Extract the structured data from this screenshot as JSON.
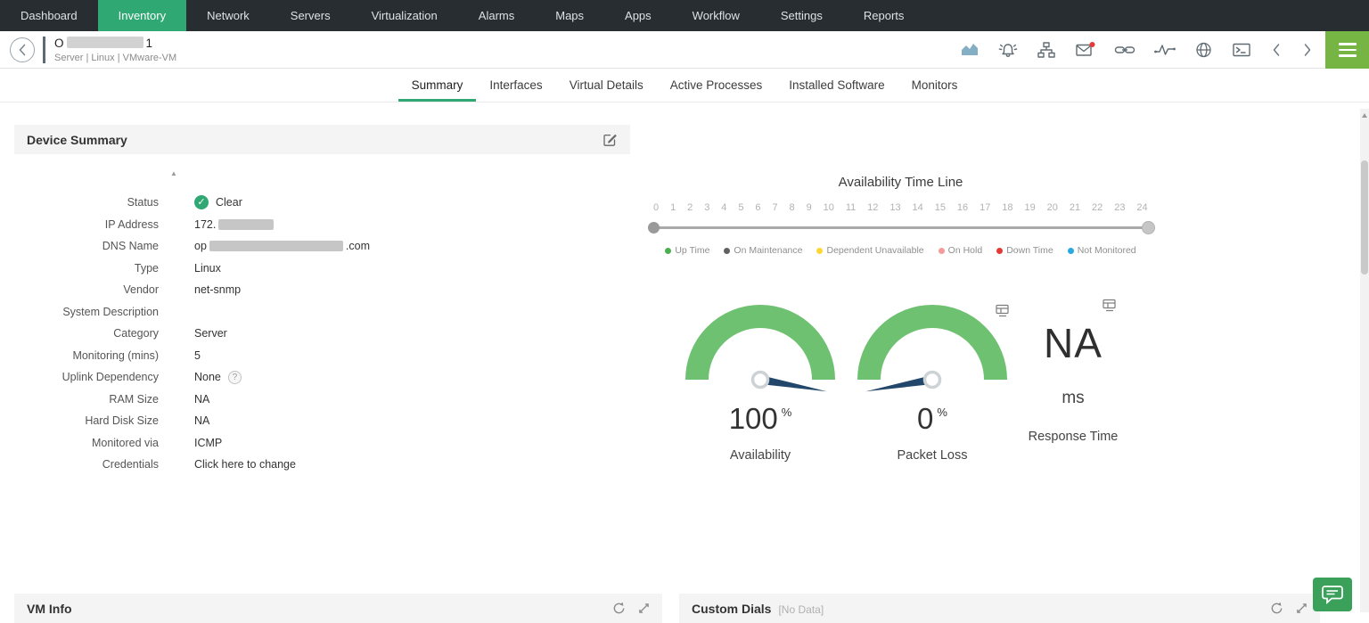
{
  "nav": {
    "items": [
      "Dashboard",
      "Inventory",
      "Network",
      "Servers",
      "Virtualization",
      "Alarms",
      "Maps",
      "Apps",
      "Workflow",
      "Settings",
      "Reports"
    ],
    "active": "Inventory"
  },
  "device_header": {
    "name_prefix": "O",
    "name_suffix": "1",
    "breadcrumb": "Server | Linux | VMware-VM",
    "icons": [
      "performance-chart-icon",
      "alarm-icon",
      "topology-icon",
      "mail-icon",
      "link-icon",
      "response-graph-icon",
      "web-icon",
      "terminal-icon",
      "previous-device-icon",
      "next-device-icon",
      "menu-icon"
    ]
  },
  "tabs": {
    "items": [
      "Summary",
      "Interfaces",
      "Virtual Details",
      "Active Processes",
      "Installed Software",
      "Monitors"
    ],
    "active": "Summary"
  },
  "device_summary": {
    "title": "Device Summary",
    "fields": [
      {
        "label": "Status",
        "value": "Clear",
        "type": "status"
      },
      {
        "label": "IP Address",
        "value": "172.",
        "type": "redacted",
        "redact_width": 62,
        "suffix": ""
      },
      {
        "label": "DNS Name",
        "value": "op",
        "type": "redacted",
        "redact_width": 150,
        "suffix": ".com"
      },
      {
        "label": "Type",
        "value": "Linux",
        "type": "text"
      },
      {
        "label": "Vendor",
        "value": "net-snmp",
        "type": "text"
      },
      {
        "label": "System Description",
        "value": "",
        "type": "text"
      },
      {
        "label": "Category",
        "value": "Server",
        "type": "text"
      },
      {
        "label": "Monitoring (mins)",
        "value": "5",
        "type": "text"
      },
      {
        "label": "Uplink Dependency",
        "value": "None",
        "type": "help"
      },
      {
        "label": "RAM Size",
        "value": "NA",
        "type": "text"
      },
      {
        "label": "Hard Disk Size",
        "value": "NA",
        "type": "text"
      },
      {
        "label": "Monitored via",
        "value": "ICMP",
        "type": "text"
      },
      {
        "label": "Credentials",
        "value": "Click here to change",
        "type": "link"
      }
    ]
  },
  "timeline": {
    "title": "Availability Time Line",
    "ticks": [
      "0",
      "1",
      "2",
      "3",
      "4",
      "5",
      "6",
      "7",
      "8",
      "9",
      "10",
      "11",
      "12",
      "13",
      "14",
      "15",
      "16",
      "17",
      "18",
      "19",
      "20",
      "21",
      "22",
      "23",
      "24"
    ],
    "legend": [
      {
        "label": "Up Time",
        "color": "#4caf50"
      },
      {
        "label": "On Maintenance",
        "color": "#616161"
      },
      {
        "label": "Dependent Unavailable",
        "color": "#fdd835"
      },
      {
        "label": "On Hold",
        "color": "#f49c9c"
      },
      {
        "label": "Down Time",
        "color": "#e53935"
      },
      {
        "label": "Not Monitored",
        "color": "#29a9e0"
      }
    ]
  },
  "dials": [
    {
      "type": "gauge",
      "value": "100",
      "unit": "%",
      "label": "Availability",
      "needle_deg": 10
    },
    {
      "type": "gauge",
      "value": "0",
      "unit": "%",
      "label": "Packet Loss",
      "needle_deg": 170
    },
    {
      "type": "text",
      "value": "NA",
      "unit": "ms",
      "label": "Response Time"
    }
  ],
  "panels": {
    "vm_info": {
      "title": "VM Info"
    },
    "custom_dials": {
      "title": "Custom Dials",
      "no_data": "[No Data]"
    }
  },
  "colors": {
    "nav_bg": "#272d30",
    "accent_green": "#2fa873",
    "menu_green": "#76b544",
    "chat_green": "#3aa05a",
    "gauge_green": "#6ec170",
    "needle_navy": "#23476b",
    "status_clear_green": "#2fa873",
    "alert_red": "#e53935"
  }
}
